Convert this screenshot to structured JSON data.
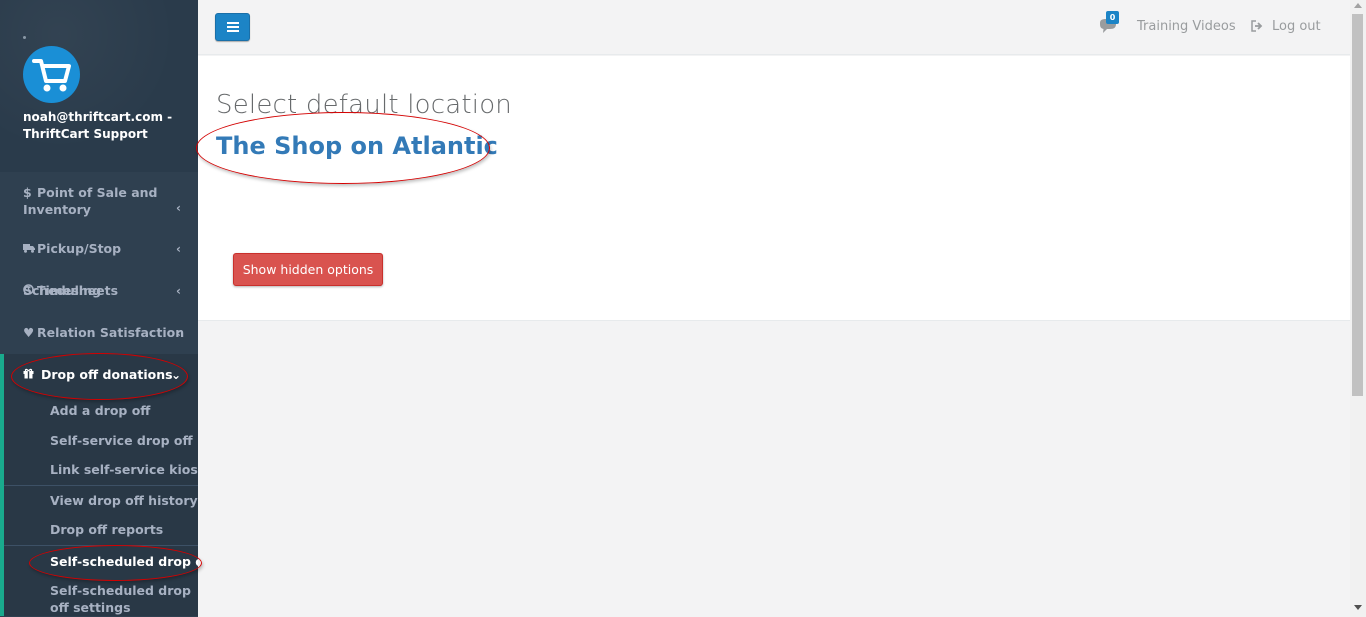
{
  "sidebar": {
    "profile_name": "noah@thriftcart.com - ThriftCart Support",
    "items": [
      {
        "label": "Point of Sale and Inventory",
        "icon": "dollar-icon"
      },
      {
        "label": "Pickup/Stop Scheduling",
        "icon": "truck-icon"
      },
      {
        "label": "Timesheets",
        "icon": "clock-icon"
      },
      {
        "label": "Relation Satisfaction",
        "icon": "heart-icon"
      }
    ],
    "active_group": {
      "label": "Drop off donations",
      "icon": "gift-icon",
      "subitems": [
        "Add a drop off",
        "Self-service drop off",
        "Link self-service kiosk",
        "View drop off history",
        "Drop off reports",
        "Self-scheduled drop offs",
        "Self-scheduled drop off settings"
      ]
    }
  },
  "topbar": {
    "notification_count": "0",
    "training_label": "Training Videos",
    "logout_label": "Log out"
  },
  "main": {
    "title": "Select default location",
    "location_name": "The Shop on Atlantic",
    "hidden_options_label": "Show hidden options"
  },
  "colors": {
    "sidebar_bg": "#2f4050",
    "accent_blue": "#1c84c6",
    "link_blue": "#337ab7",
    "danger_red": "#d9534f",
    "active_border": "#19aa8d",
    "annotation_red": "#d40000"
  }
}
